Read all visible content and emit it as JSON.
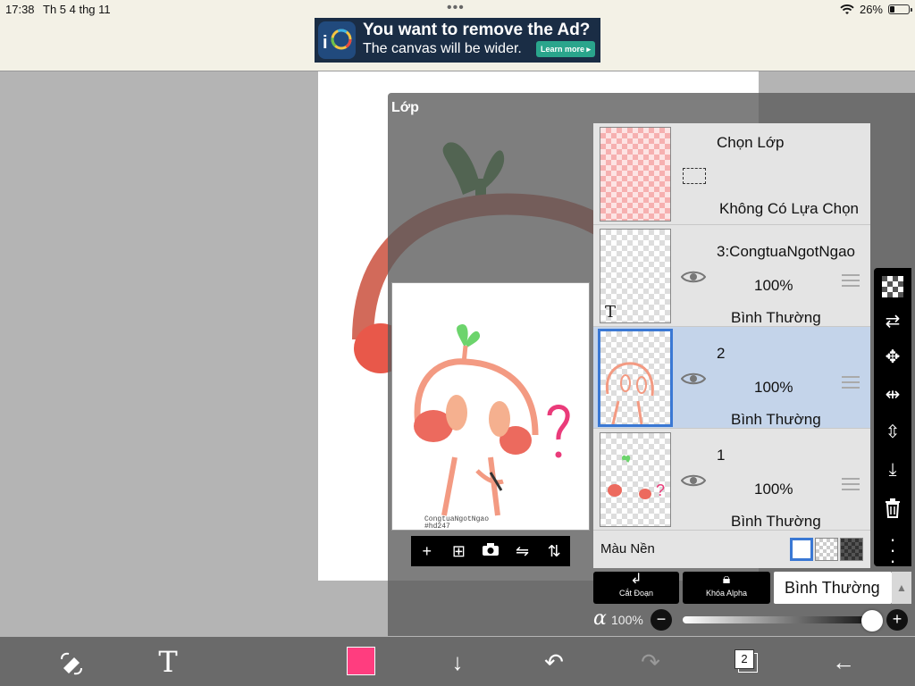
{
  "status_bar": {
    "time": "17:38",
    "date": "Th 5 4 thg 11",
    "battery": "26%",
    "battery_level": 0.26
  },
  "ad": {
    "title": "You want to remove the Ad?",
    "subtitle": "The canvas will be wider.",
    "cta": "Learn more ▸"
  },
  "layers_dialog": {
    "title": "Lớp",
    "selection_layer": {
      "title": "Chọn Lớp",
      "status": "Không Có Lựa Chọn"
    },
    "layers": [
      {
        "name": "3:CongtuaNgotNgao",
        "opacity": "100%",
        "blend": "Bình Thường",
        "selected": false
      },
      {
        "name": "2",
        "opacity": "100%",
        "blend": "Bình Thường",
        "selected": true
      },
      {
        "name": "1",
        "opacity": "100%",
        "blend": "Bình Thường",
        "selected": false
      }
    ],
    "background": {
      "label": "Màu Nền"
    },
    "clipping_label": "Cắt Đoạn",
    "alpha_lock_label": "Khóa Alpha",
    "blend_mode": "Bình Thường",
    "alpha_symbol": "α",
    "alpha_value": "100%",
    "alpha_level": 1.0,
    "preview_watermark": [
      "CongtuaNgotNgao",
      "#hd247"
    ]
  },
  "bottom_toolbar": {
    "layer_count": "2",
    "current_color": "#ff3d7f"
  },
  "colors": {
    "selected_row": "#c4d4ea",
    "selected_border": "#3a78d4",
    "ad_button": "#2aa58c"
  }
}
